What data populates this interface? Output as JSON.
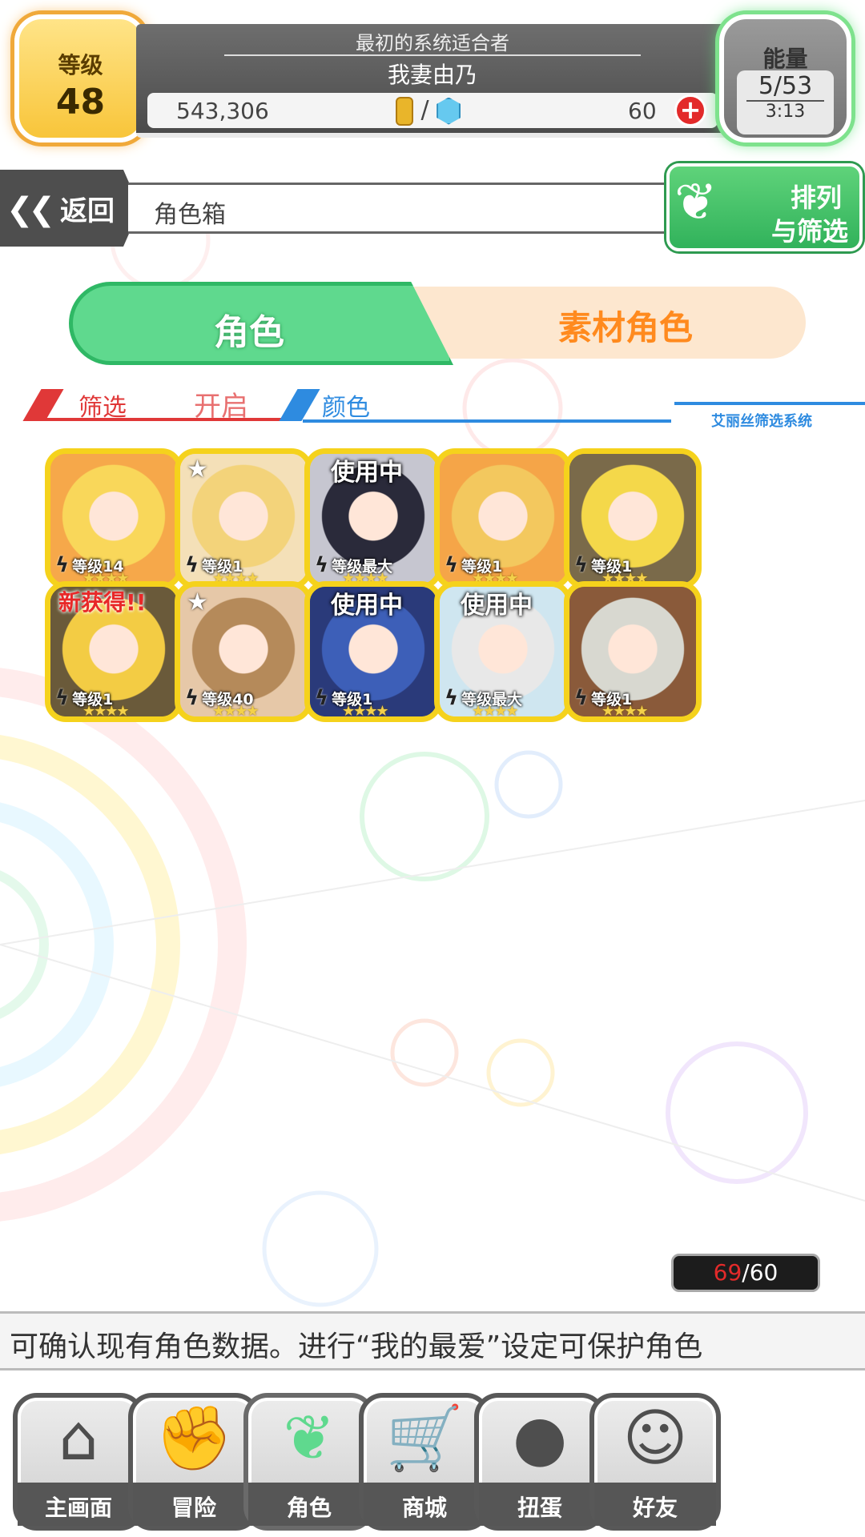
{
  "header": {
    "level_label": "等级",
    "level_value": "48",
    "title": "最初的系统适合者",
    "player_name": "我妻由乃",
    "gold": "543,306",
    "currency_separator": "/",
    "gems": "60",
    "energy_label": "能量",
    "energy_value": "5/53",
    "energy_timer": "3:13"
  },
  "nav": {
    "back_label": "返回",
    "breadcrumb": "角色箱",
    "sort_line1": "排列",
    "sort_line2": "与筛选"
  },
  "tabs": {
    "characters": "角色",
    "materials": "素材角色"
  },
  "filter": {
    "filter_label": "筛选",
    "filter_state": "开启",
    "color_label": "颜色",
    "system_name": "艾丽丝筛选系统"
  },
  "characters": [
    {
      "level": "等级14",
      "badge": "",
      "star": false,
      "bg": "#f6a84a",
      "hair": "#f9d75a"
    },
    {
      "level": "等级1",
      "badge": "",
      "star": true,
      "bg": "#f4e0b8",
      "hair": "#f3d37a"
    },
    {
      "level": "等级最大",
      "badge": "使用中",
      "star": false,
      "bg": "#c6c6d0",
      "hair": "#2a2a3a"
    },
    {
      "level": "等级1",
      "badge": "",
      "star": false,
      "bg": "#f5a548",
      "hair": "#f3c85e"
    },
    {
      "level": "等级1",
      "badge": "",
      "star": false,
      "bg": "#7a6a4a",
      "hair": "#f4d84a"
    },
    {
      "level": "等级1",
      "badge": "新获得!!",
      "star": false,
      "bg": "#6a5a3a",
      "hair": "#f3cc44"
    },
    {
      "level": "等级40",
      "badge": "",
      "star": true,
      "bg": "#e6c8a8",
      "hair": "#b58a5a"
    },
    {
      "level": "等级1",
      "badge": "使用中",
      "star": false,
      "bg": "#2a3a7a",
      "hair": "#3d5fb8"
    },
    {
      "level": "等级最大",
      "badge": "使用中",
      "star": false,
      "bg": "#cfe6f0",
      "hair": "#e8e8e8"
    },
    {
      "level": "等级1",
      "badge": "",
      "star": false,
      "bg": "#8a5a3a",
      "hair": "#d8d8d0"
    }
  ],
  "counter": {
    "current": "69",
    "max": "/60"
  },
  "marquee_text": "可确认现有角色数据。进行“我的最爱”设定可保护角色",
  "bottom_nav": [
    {
      "label": "主画面",
      "icon": "home-icon",
      "glyph": "⌂"
    },
    {
      "label": "冒险",
      "icon": "handshake-icon",
      "glyph": "✊"
    },
    {
      "label": "角色",
      "icon": "rabbit-icon",
      "glyph": "❦"
    },
    {
      "label": "商城",
      "icon": "cart-icon",
      "glyph": "🛒"
    },
    {
      "label": "扭蛋",
      "icon": "egg-icon",
      "glyph": "●"
    },
    {
      "label": "好友",
      "icon": "friends-icon",
      "glyph": "☺"
    }
  ],
  "colors": {
    "accent_green": "#5fd98e",
    "accent_orange": "#ff8a1e",
    "filter_red": "#e03838",
    "filter_blue": "#2e8be0",
    "card_border": "#f5d21c"
  }
}
